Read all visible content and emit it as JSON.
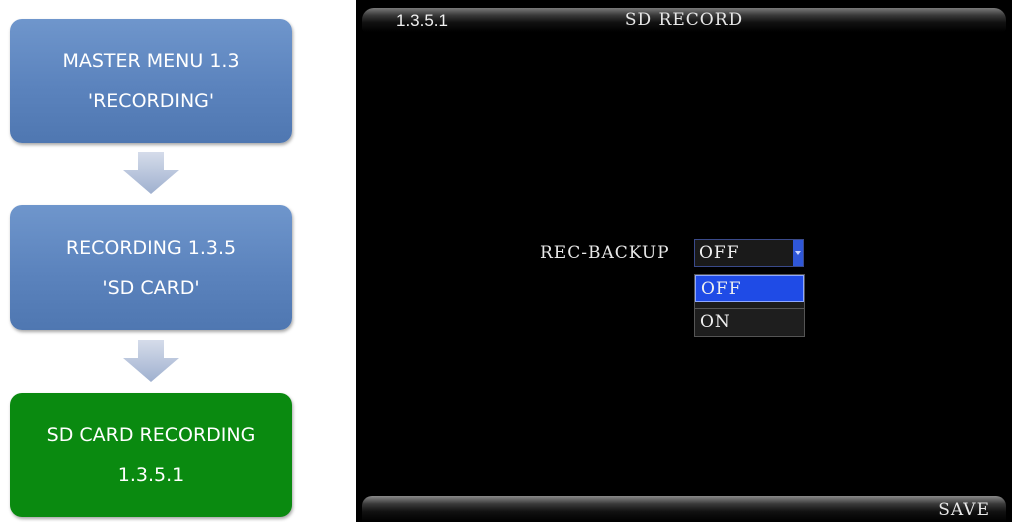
{
  "flow": {
    "steps": [
      {
        "line1": "MASTER MENU 1.3",
        "line2": "'RECORDING'"
      },
      {
        "line1": "RECORDING 1.3.5",
        "line2": "'SD CARD'"
      },
      {
        "line1": "SD CARD RECORDING",
        "line2": "1.3.5.1"
      }
    ],
    "arrow_icon": "down-arrow-icon",
    "colors": {
      "step_blue": "#5b83bd",
      "step_active_green": "#0a8a10"
    }
  },
  "screen": {
    "menu_id": "1.3.5.1",
    "title": "SD RECORD",
    "field": {
      "label": "REC-BACKUP",
      "value": "OFF",
      "options": [
        "OFF",
        "ON"
      ],
      "highlighted_option": "OFF"
    },
    "save_label": "SAVE",
    "colors": {
      "background": "#000000",
      "highlight": "#1f4be6"
    }
  }
}
